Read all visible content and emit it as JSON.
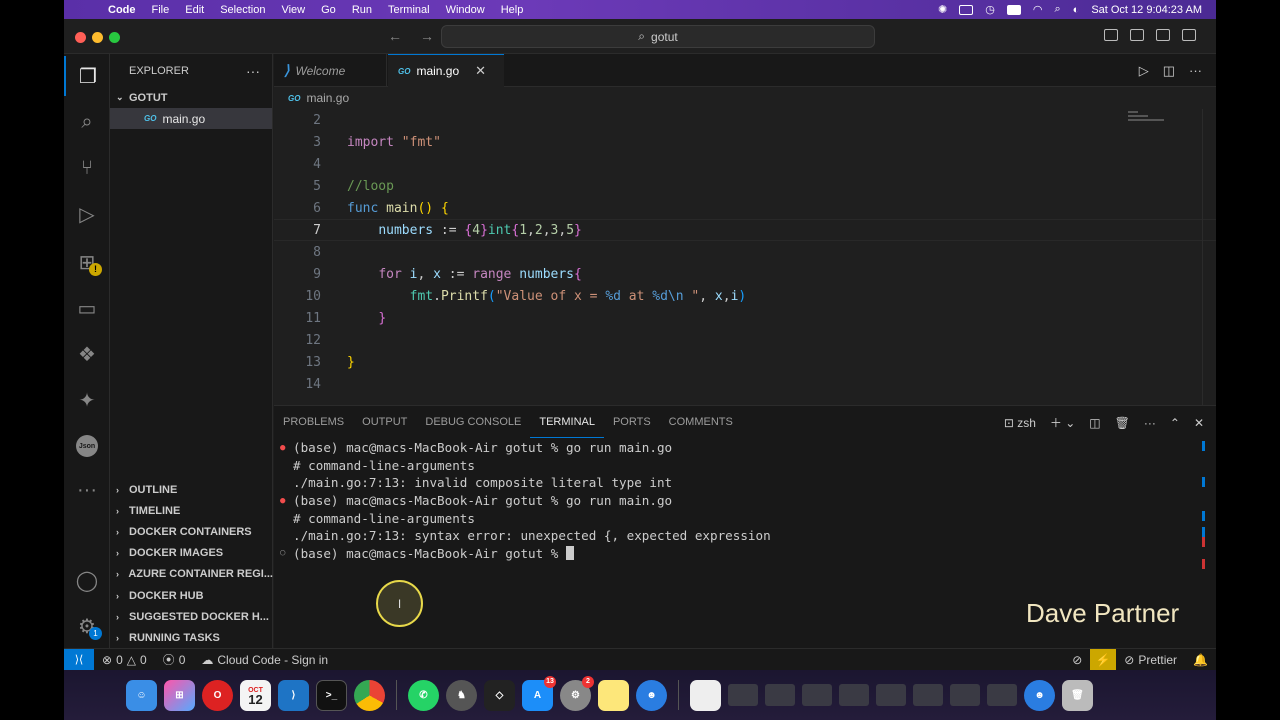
{
  "menubar": {
    "app": "Code",
    "items": [
      "File",
      "Edit",
      "Selection",
      "View",
      "Go",
      "Run",
      "Terminal",
      "Window",
      "Help"
    ],
    "clock": "Sat Oct 12  9:04:23 AM"
  },
  "titlebar": {
    "search": "gotut"
  },
  "explorer": {
    "title": "EXPLORER",
    "folder": "GOTUT",
    "file": "main.go",
    "sections": [
      "OUTLINE",
      "TIMELINE",
      "DOCKER CONTAINERS",
      "DOCKER IMAGES",
      "AZURE CONTAINER REGI...",
      "DOCKER HUB",
      "SUGGESTED DOCKER H...",
      "RUNNING TASKS"
    ]
  },
  "tabs": {
    "welcome": "Welcome",
    "main": "main.go"
  },
  "breadcrumb": "main.go",
  "editor": {
    "line_numbers": [
      "2",
      "3",
      "4",
      "5",
      "6",
      "7",
      "8",
      "9",
      "10",
      "11",
      "12",
      "13",
      "14"
    ],
    "current_line": "7"
  },
  "panel": {
    "tabs": [
      "PROBLEMS",
      "OUTPUT",
      "DEBUG CONSOLE",
      "TERMINAL",
      "PORTS",
      "COMMENTS"
    ],
    "shell": "zsh",
    "lines": [
      "(base) mac@macs-MacBook-Air gotut % go run main.go",
      "# command-line-arguments",
      "./main.go:7:13: invalid composite literal type int",
      "(base) mac@macs-MacBook-Air gotut % go run main.go",
      "# command-line-arguments",
      "./main.go:7:13: syntax error: unexpected {, expected expression",
      "(base) mac@macs-MacBook-Air gotut % "
    ]
  },
  "watermark": "Dave Partner",
  "status": {
    "errors": "0",
    "warnings": "0",
    "ports": "0",
    "cloud": "Cloud Code - Sign in",
    "prettier": "Prettier"
  },
  "dock": {
    "calendar_month": "OCT",
    "calendar_day": "12",
    "appstore_badge": "13",
    "settings_badge": "2"
  }
}
